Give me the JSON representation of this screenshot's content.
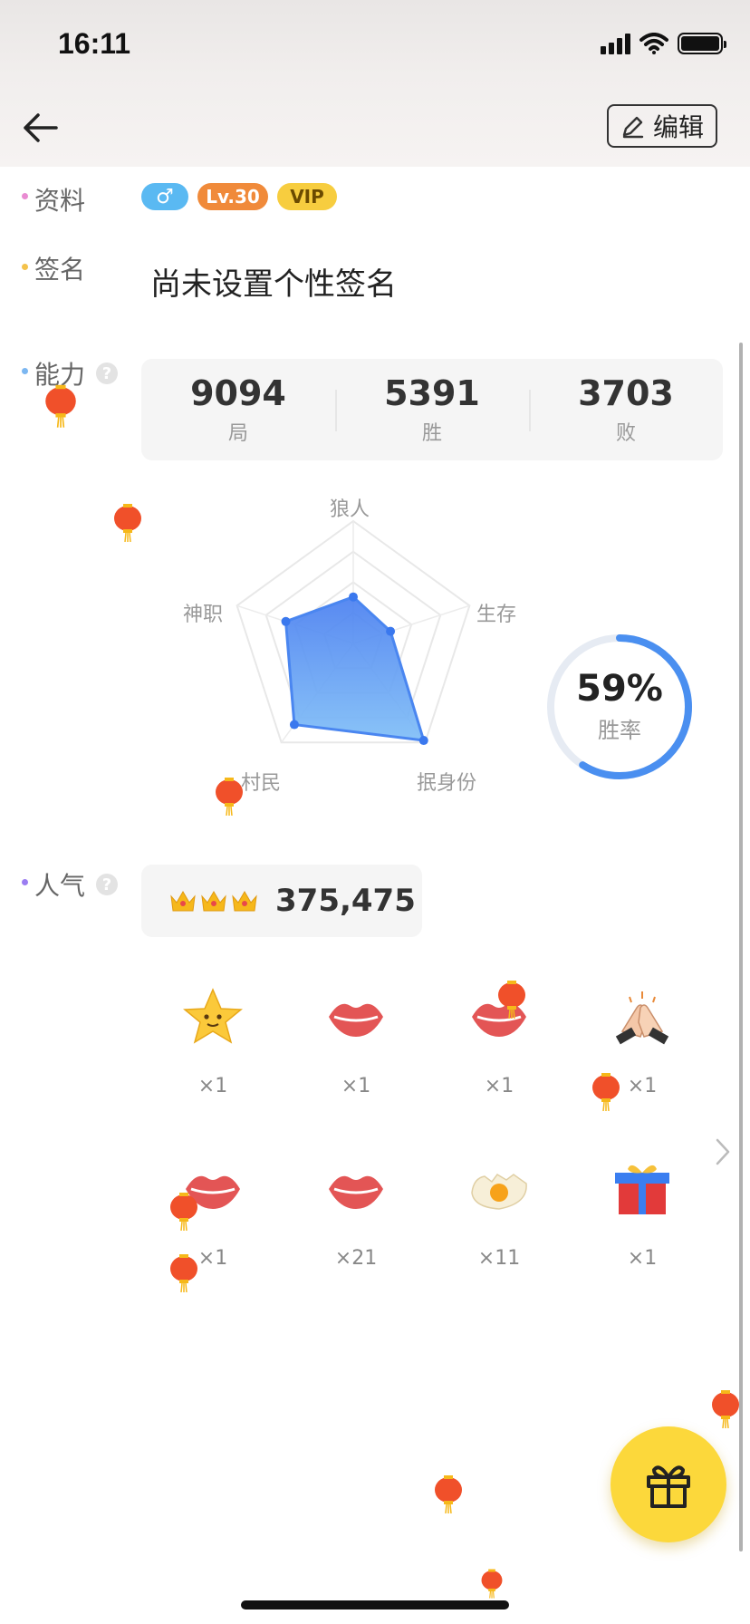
{
  "status_bar": {
    "time": "16:11"
  },
  "header": {
    "edit_label": "编辑"
  },
  "profile": {
    "info_label": "资料",
    "gender_symbol": "♂",
    "level": "Lv.30",
    "vip": "VIP",
    "signature_label": "签名",
    "signature": "尚未设置个性签名"
  },
  "ability": {
    "label": "能力",
    "help": "?",
    "stats": [
      {
        "value": "9094",
        "label": "局"
      },
      {
        "value": "5391",
        "label": "胜"
      },
      {
        "value": "3703",
        "label": "败"
      }
    ],
    "radar_axes": [
      "狼人",
      "生存",
      "抿身份",
      "村民",
      "神职"
    ],
    "radar_values": [
      0.38,
      0.32,
      0.98,
      0.82,
      0.58
    ],
    "winrate": "59%",
    "winrate_fraction": 0.59,
    "winrate_label": "胜率"
  },
  "popularity": {
    "label": "人气",
    "help": "?",
    "value": "375,475",
    "crown_count": 3
  },
  "gifts": [
    {
      "icon": "star-face-icon",
      "count": "×1"
    },
    {
      "icon": "lips-icon",
      "count": "×1"
    },
    {
      "icon": "lips-icon",
      "count": "×1"
    },
    {
      "icon": "clapping-hands-icon",
      "count": "×1"
    },
    {
      "icon": "lips-icon",
      "count": "×1"
    },
    {
      "icon": "lips-icon",
      "count": "×21"
    },
    {
      "icon": "egg-icon",
      "count": "×11"
    },
    {
      "icon": "gift-box-icon",
      "count": "×1"
    }
  ],
  "colors": {
    "accent_blue": "#4a8ff0",
    "level_orange": "#f08a3a",
    "vip_yellow": "#f7cd3f",
    "gender_blue": "#5ab9f2",
    "fab_yellow": "#fcd83b"
  }
}
